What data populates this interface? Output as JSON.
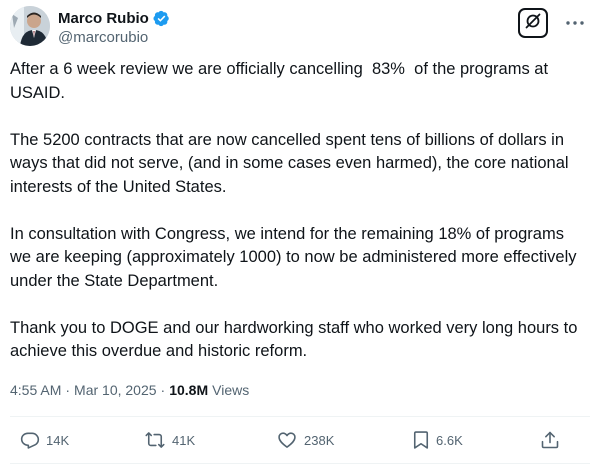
{
  "author": {
    "display_name": "Marco Rubio",
    "handle": "@marcorubio",
    "verified": true,
    "verified_color": "#1d9bf0"
  },
  "post": {
    "paragraphs": [
      "After a 6 week review we are officially cancelling  83%  of the programs at USAID.",
      "The 5200 contracts that are now cancelled spent tens of billions of dollars in ways that did not serve, (and in some cases even harmed), the core national interests of the United States.",
      "In consultation with Congress, we intend for the remaining 18% of programs we are keeping (approximately 1000) to now be administered more effectively under the State Department.",
      "Thank you to DOGE and our hardworking staff who worked very long hours to achieve this overdue and historic reform."
    ],
    "time": "4:55 AM",
    "date": "Mar 10, 2025",
    "separator": "·",
    "views_count": "10.8M",
    "views_label": "Views"
  },
  "actions": {
    "replies": "14K",
    "reposts": "41K",
    "likes": "238K",
    "bookmarks": "6.6K"
  },
  "icons": {
    "reply": "reply-icon",
    "repost": "repost-icon",
    "like": "heart-icon",
    "bookmark": "bookmark-icon",
    "share": "share-icon",
    "grok": "grok-icon",
    "more": "more-icon"
  }
}
